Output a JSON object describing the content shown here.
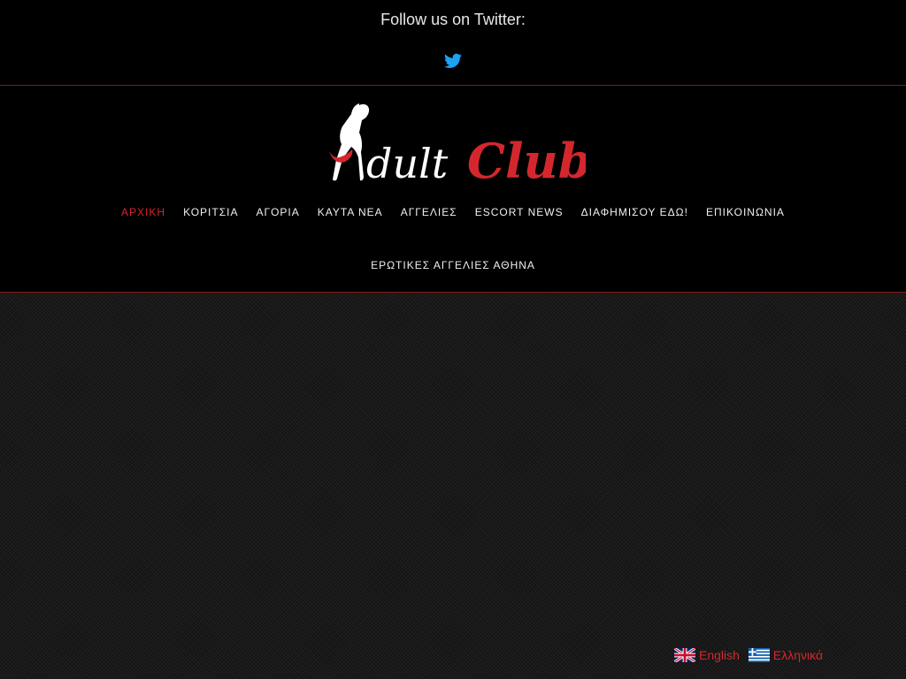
{
  "topbar": {
    "follow_text": "Follow us on Twitter:",
    "twitter_icon": "twitter-icon",
    "twitter_color": "#1da1f2"
  },
  "header": {
    "logo_text_1": "dult",
    "logo_text_2": "Club",
    "logo_color": "#d4272d"
  },
  "nav": {
    "row1": [
      {
        "label": "ΑΡΧΙΚΗ",
        "active": true
      },
      {
        "label": "ΚΟΡΙΤΣΙΑ",
        "active": false
      },
      {
        "label": "ΑΓΟΡΙΑ",
        "active": false
      },
      {
        "label": "ΚΑΥΤΑ ΝΕΑ",
        "active": false
      },
      {
        "label": "ΑΓΓΕΛΙΕΣ",
        "active": false
      },
      {
        "label": "ESCORT NEWS",
        "active": false
      },
      {
        "label": "ΔΙΑΦΗΜΙΣΟΥ ΕΔΩ!",
        "active": false
      },
      {
        "label": "ΕΠΙΚΟΙΝΩΝΙΑ",
        "active": false
      }
    ],
    "row2": [
      {
        "label": "ΕΡΩΤΙΚΕΣ ΑΓΓΕΛΙΕΣ ΑΘΗΝΑ",
        "active": false
      }
    ]
  },
  "languages": [
    {
      "label": "English",
      "flag": "uk-flag-icon"
    },
    {
      "label": "Ελληνικά",
      "flag": "greece-flag-icon"
    }
  ],
  "colors": {
    "accent": "#d4272d",
    "divider": "#8a1a1a",
    "background": "#000000"
  }
}
